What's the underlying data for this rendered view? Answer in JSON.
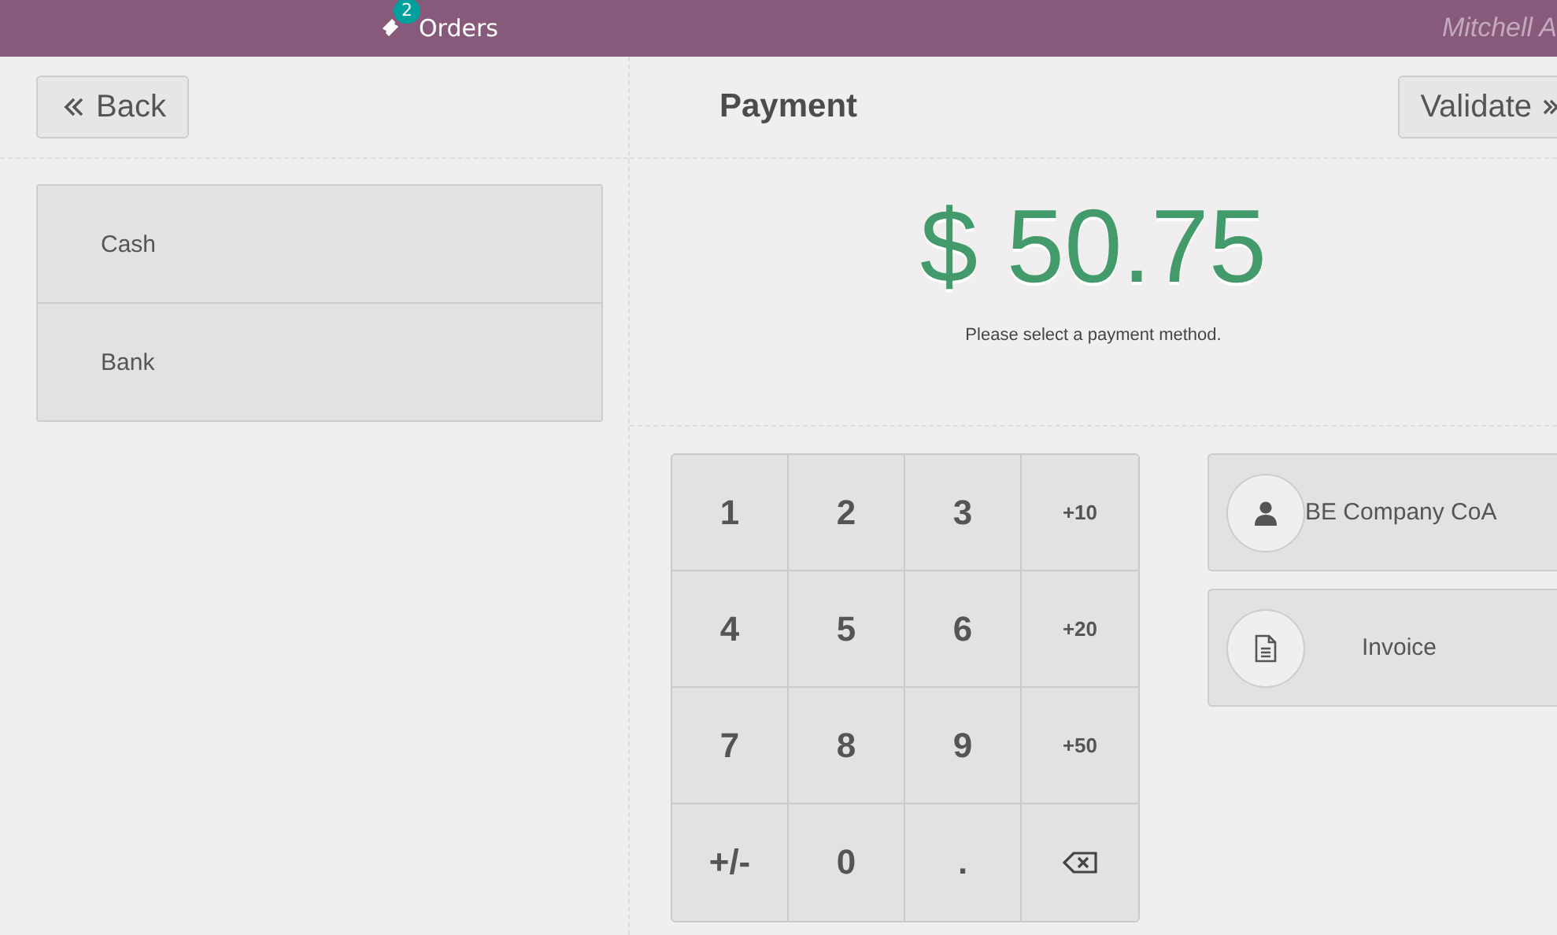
{
  "topbar": {
    "orders_label": "Orders",
    "orders_count": "2",
    "user": "Mitchell A"
  },
  "header": {
    "back": "Back",
    "title": "Payment",
    "validate": "Validate"
  },
  "payment_methods": [
    {
      "label": "Cash"
    },
    {
      "label": "Bank"
    }
  ],
  "amount": "$ 50.75",
  "message": "Please select a payment method.",
  "numpad": [
    {
      "kind": "digit",
      "label": "1"
    },
    {
      "kind": "digit",
      "label": "2"
    },
    {
      "kind": "digit",
      "label": "3"
    },
    {
      "kind": "add",
      "label": "+10"
    },
    {
      "kind": "digit",
      "label": "4"
    },
    {
      "kind": "digit",
      "label": "5"
    },
    {
      "kind": "digit",
      "label": "6"
    },
    {
      "kind": "add",
      "label": "+20"
    },
    {
      "kind": "digit",
      "label": "7"
    },
    {
      "kind": "digit",
      "label": "8"
    },
    {
      "kind": "digit",
      "label": "9"
    },
    {
      "kind": "add",
      "label": "+50"
    },
    {
      "kind": "digit",
      "label": "+/-"
    },
    {
      "kind": "digit",
      "label": "0"
    },
    {
      "kind": "digit",
      "label": "."
    },
    {
      "kind": "backspace"
    }
  ],
  "actions": [
    {
      "kind": "customer",
      "label": "BE Company CoA"
    },
    {
      "kind": "invoice",
      "label": "Invoice"
    }
  ]
}
